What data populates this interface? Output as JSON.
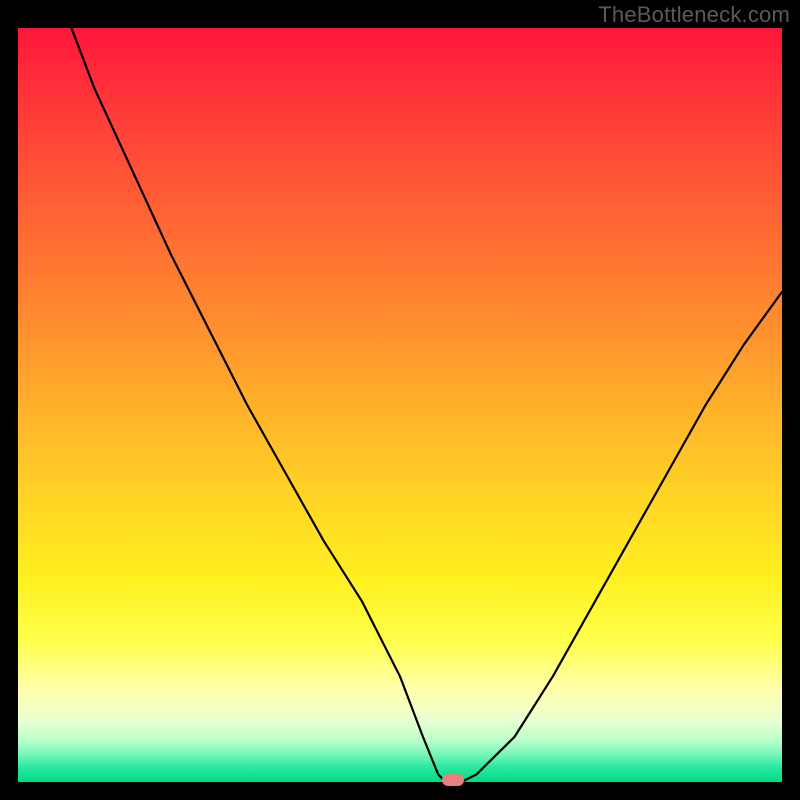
{
  "watermark": "TheBottleneck.com",
  "chart_data": {
    "type": "line",
    "title": "",
    "xlabel": "",
    "ylabel": "",
    "xlim": [
      0,
      100
    ],
    "ylim": [
      0,
      100
    ],
    "grid": false,
    "legend": false,
    "series": [
      {
        "name": "bottleneck-curve",
        "x": [
          7,
          10,
          15,
          20,
          25,
          30,
          35,
          40,
          45,
          50,
          53,
          55,
          56,
          58,
          60,
          65,
          70,
          75,
          80,
          85,
          90,
          95,
          100
        ],
        "values": [
          100,
          92,
          81,
          70,
          60,
          50,
          41,
          32,
          24,
          14,
          6,
          1,
          0,
          0,
          1,
          6,
          14,
          23,
          32,
          41,
          50,
          58,
          65
        ]
      }
    ],
    "annotations": [
      {
        "name": "optimal-marker",
        "x": 57,
        "y": 0.3
      }
    ],
    "background_gradient": {
      "top": "#ff153b",
      "mid_upper": "#ff8a2f",
      "mid": "#ffd325",
      "mid_lower": "#ffff4a",
      "bottom": "#00db82"
    }
  }
}
